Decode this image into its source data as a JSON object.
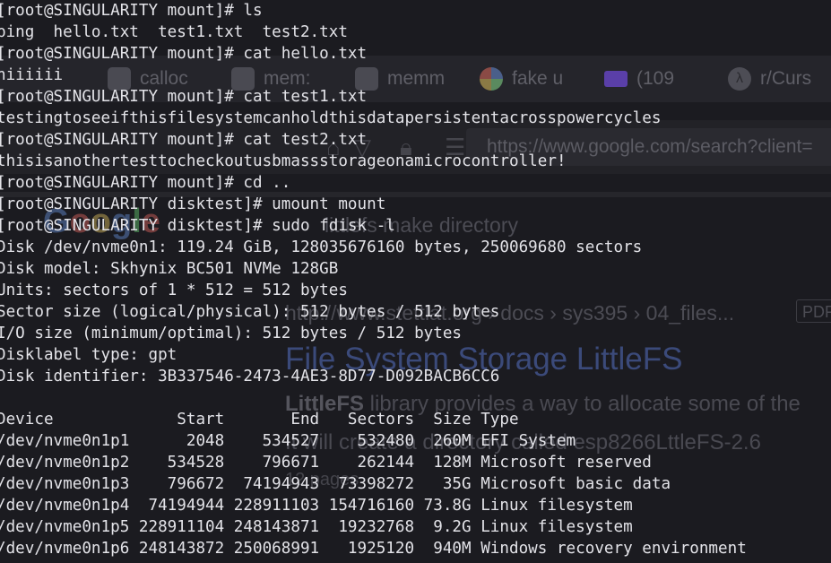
{
  "background_browser": {
    "tabs": [
      {
        "label": "calloc",
        "icon": "generic-tab-icon"
      },
      {
        "label": "mem:",
        "icon": "generic-tab-icon"
      },
      {
        "label": "memm",
        "icon": "generic-tab-icon"
      },
      {
        "label": "fake u",
        "icon": "google-icon"
      },
      {
        "label": "(109",
        "icon": "mail-icon"
      },
      {
        "label": "r/Curs",
        "icon": "lambda-icon"
      }
    ],
    "url": "https://www.google.com/search?client=",
    "search_query": "littlefs make directory",
    "result": {
      "cite": "http://www.stettlat.org › docs › sys395 › 04_files...",
      "badge": "PDF",
      "title": "File System Storage LittleFS",
      "snippet_bold": "LittleFS",
      "snippet_line1": " library provides a way to allocate some of the",
      "snippet_line2": "It will create a directory called esp8266LttleFS-2.6",
      "pages": "12 pages"
    }
  },
  "terminal": {
    "lines": [
      "[root@SINGULARITY mount]# ls",
      "bing  hello.txt  test1.txt  test2.txt",
      "[root@SINGULARITY mount]# cat hello.txt",
      "hiiiiii",
      "[root@SINGULARITY mount]# cat test1.txt",
      "testingtoseeifthisfilesystemcanholdthisdatapersistentacrosspowercycles",
      "[root@SINGULARITY mount]# cat test2.txt",
      "thisisanothertesttocheckoutusbmassstorageonamicrocontroller!",
      "[root@SINGULARITY mount]# cd ..",
      "[root@SINGULARITY disktest]# umount mount",
      "[root@SINGULARITY disktest]# sudo fdisk -l",
      "Disk /dev/nvme0n1: 119.24 GiB, 128035676160 bytes, 250069680 sectors",
      "Disk model: Skhynix BC501 NVMe 128GB",
      "Units: sectors of 1 * 512 = 512 bytes",
      "Sector size (logical/physical): 512 bytes / 512 bytes",
      "I/O size (minimum/optimal): 512 bytes / 512 bytes",
      "Disklabel type: gpt",
      "Disk identifier: 3B337546-2473-4AE3-8D77-D092BACB6CC6",
      "",
      "Device             Start       End   Sectors  Size Type",
      "/dev/nvme0n1p1      2048    534527    532480  260M EFI System",
      "/dev/nvme0n1p2    534528    796671    262144  128M Microsoft reserved",
      "/dev/nvme0n1p3    796672  74194943  73398272   35G Microsoft basic data",
      "/dev/nvme0n1p4  74194944 228911103 154716160 73.8G Linux filesystem",
      "/dev/nvme0n1p5 228911104 248143871  19232768  9.2G Linux filesystem",
      "/dev/nvme0n1p6 248143872 250068991   1925120  940M Windows recovery environment"
    ]
  }
}
